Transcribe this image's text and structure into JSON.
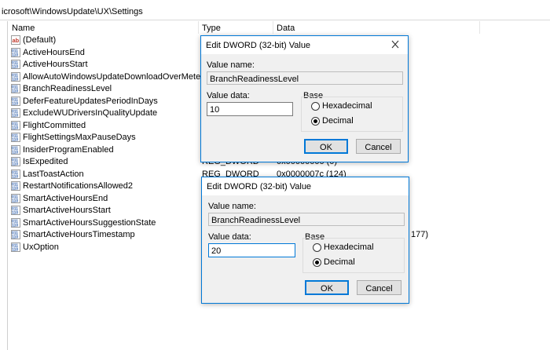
{
  "address": {
    "path": "icrosoft\\WindowsUpdate\\UX\\Settings"
  },
  "columns": {
    "name": "Name",
    "type": "Type",
    "data": "Data"
  },
  "rows": [
    {
      "name": "(Default)",
      "type": "",
      "data": "",
      "icon": "string-value-icon"
    },
    {
      "name": "ActiveHoursEnd",
      "type": "",
      "data": "",
      "icon": "binary-value-icon"
    },
    {
      "name": "ActiveHoursStart",
      "type": "",
      "data": "",
      "icon": "binary-value-icon"
    },
    {
      "name": "AllowAutoWindowsUpdateDownloadOverMetered...",
      "type": "",
      "data": "",
      "icon": "binary-value-icon"
    },
    {
      "name": "BranchReadinessLevel",
      "type": "",
      "data": "",
      "icon": "binary-value-icon"
    },
    {
      "name": "DeferFeatureUpdatesPeriodInDays",
      "type": "",
      "data": "",
      "icon": "binary-value-icon"
    },
    {
      "name": "ExcludeWUDriversInQualityUpdate",
      "type": "",
      "data": "",
      "icon": "binary-value-icon"
    },
    {
      "name": "FlightCommitted",
      "type": "",
      "data": "",
      "icon": "binary-value-icon"
    },
    {
      "name": "FlightSettingsMaxPauseDays",
      "type": "",
      "data": "",
      "icon": "binary-value-icon"
    },
    {
      "name": "InsiderProgramEnabled",
      "type": "",
      "data": "",
      "icon": "binary-value-icon"
    },
    {
      "name": "IsExpedited",
      "type": "REG_DWORD",
      "data": "0x00000000 (0)",
      "icon": "binary-value-icon"
    },
    {
      "name": "LastToastAction",
      "type": "REG_DWORD",
      "data": "0x0000007c (124)",
      "icon": "binary-value-icon"
    },
    {
      "name": "RestartNotificationsAllowed2",
      "type": "",
      "data": "",
      "icon": "binary-value-icon"
    },
    {
      "name": "SmartActiveHoursEnd",
      "type": "",
      "data": "",
      "icon": "binary-value-icon"
    },
    {
      "name": "SmartActiveHoursStart",
      "type": "",
      "data": "",
      "icon": "binary-value-icon"
    },
    {
      "name": "SmartActiveHoursSuggestionState",
      "type": "",
      "data": "",
      "icon": "binary-value-icon"
    },
    {
      "name": "SmartActiveHoursTimestamp",
      "type": "",
      "data": "177)",
      "icon": "binary-value-icon"
    },
    {
      "name": "UxOption",
      "type": "",
      "data": "",
      "icon": "binary-value-icon"
    }
  ],
  "dialog1": {
    "title": "Edit DWORD (32-bit) Value",
    "value_name_label": "Value name:",
    "value_name": "BranchReadinessLevel",
    "value_data_label": "Value data:",
    "value_data": "10",
    "base_label": "Base",
    "hex_label": "Hexadecimal",
    "dec_label": "Decimal",
    "selected_base": "Decimal",
    "ok": "OK",
    "cancel": "Cancel"
  },
  "dialog2": {
    "title": "Edit DWORD (32-bit) Value",
    "value_name_label": "Value name:",
    "value_name": "BranchReadinessLevel",
    "value_data_label": "Value data:",
    "value_data": "20",
    "base_label": "Base",
    "hex_label": "Hexadecimal",
    "dec_label": "Decimal",
    "selected_base": "Decimal",
    "ok": "OK",
    "cancel": "Cancel"
  },
  "colors": {
    "accent": "#0078d7",
    "string_icon": "#c0392b",
    "binary_icon": "#2a5caa"
  }
}
